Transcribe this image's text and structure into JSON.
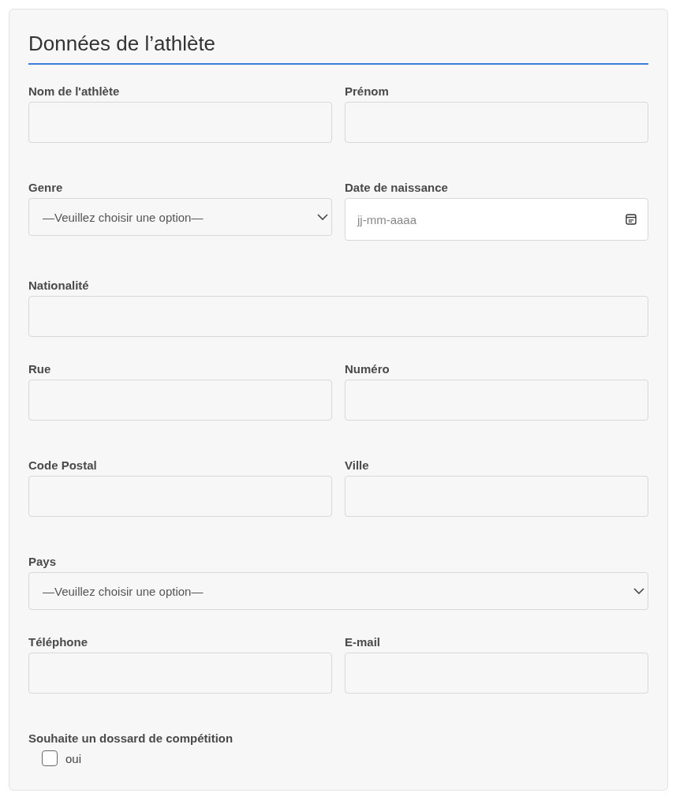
{
  "title": "Données de l’athlète",
  "rows": [
    {
      "fields": [
        {
          "kind": "text",
          "label": "Nom de l'athlète"
        },
        {
          "kind": "text",
          "label": "Prénom"
        }
      ]
    },
    {
      "fields": [
        {
          "kind": "select",
          "label": "Genre",
          "value": "—Veuillez choisir une option—"
        },
        {
          "kind": "date",
          "label": "Date de naissance",
          "placeholder": "jj-mm-aaaa"
        }
      ]
    },
    {
      "fields": [
        {
          "kind": "text",
          "label": "Nationalité"
        }
      ]
    },
    {
      "fields": [
        {
          "kind": "text",
          "label": "Rue"
        },
        {
          "kind": "text",
          "label": "Numéro"
        }
      ]
    },
    {
      "fields": [
        {
          "kind": "text",
          "label": "Code Postal"
        },
        {
          "kind": "text",
          "label": "Ville"
        }
      ]
    },
    {
      "fields": [
        {
          "kind": "select",
          "label": "Pays",
          "value": "—Veuillez choisir une option—"
        }
      ]
    },
    {
      "fields": [
        {
          "kind": "text",
          "label": "Téléphone"
        },
        {
          "kind": "text",
          "label": "E-mail"
        }
      ]
    },
    {
      "fields": [
        {
          "kind": "checkbox",
          "label": "Souhaite un dossard de compétition",
          "option": "oui",
          "checked": false
        }
      ]
    }
  ]
}
